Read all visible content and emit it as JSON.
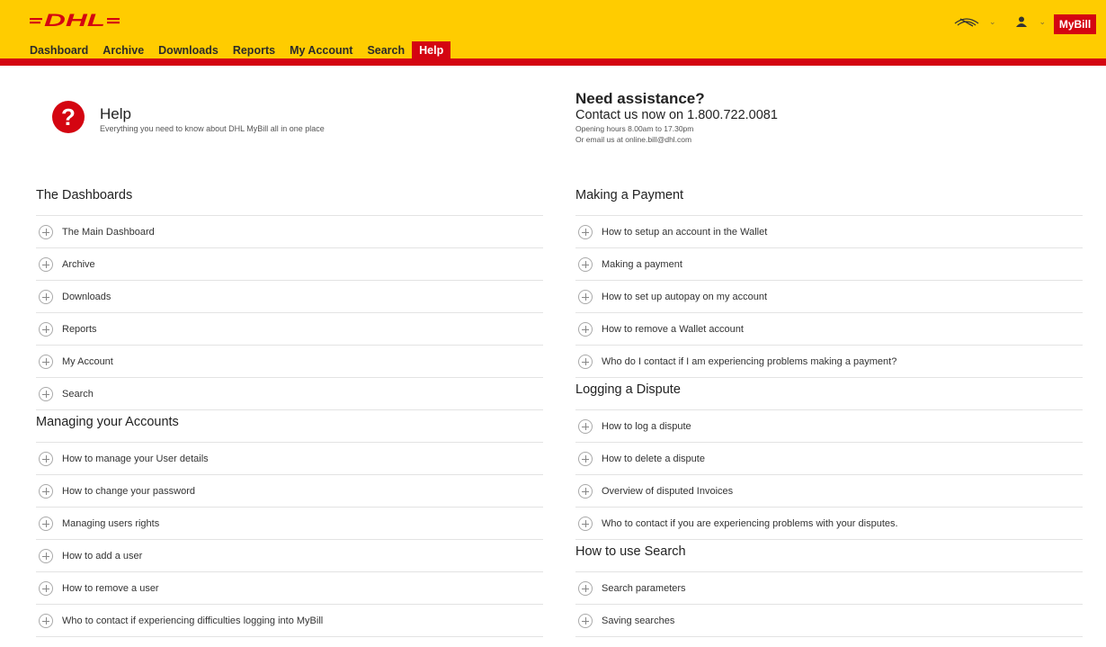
{
  "colors": {
    "header_bg": "#ffcc00",
    "accent_red": "#d40511"
  },
  "header": {
    "logo_text": "DHL",
    "nav": [
      {
        "label": "Dashboard"
      },
      {
        "label": "Archive"
      },
      {
        "label": "Downloads"
      },
      {
        "label": "Reports"
      },
      {
        "label": "My Account"
      },
      {
        "label": "Search"
      },
      {
        "label": "Help",
        "active": true
      }
    ],
    "icons": [
      "language-icon",
      "user-icon"
    ],
    "mybill_label": "MyBill"
  },
  "help": {
    "badge": "?",
    "title": "Help",
    "subtitle": "Everything you need to know about DHL MyBill all in one place"
  },
  "assistance": {
    "title": "Need assistance?",
    "contact": "Contact us now on 1.800.722.0081",
    "hours": "Opening hours 8.00am to 17.30pm",
    "email": "Or email us at online.bill@dhl.com"
  },
  "left_sections": [
    {
      "title": "The Dashboards",
      "items": [
        "The Main Dashboard",
        "Archive",
        "Downloads",
        "Reports",
        "My Account",
        "Search"
      ]
    },
    {
      "title": "Managing your Accounts",
      "items": [
        "How to manage your User details",
        "How to change your password",
        "Managing users rights",
        "How to add a user",
        "How to remove a user",
        "Who to contact if experiencing difficulties logging into MyBill"
      ]
    }
  ],
  "right_sections": [
    {
      "title": "Making a Payment",
      "items": [
        "How to setup an account in the Wallet",
        "Making a payment",
        "How to set up autopay on my account",
        "How to remove a Wallet account",
        "Who do I contact if I am experiencing problems making a payment?"
      ]
    },
    {
      "title": "Logging a Dispute",
      "items": [
        "How to log a dispute",
        "How to delete a dispute",
        "Overview of disputed Invoices",
        "Who to contact if you are experiencing problems with your disputes."
      ]
    },
    {
      "title": "How to use Search",
      "items": [
        "Search parameters",
        "Saving searches"
      ]
    }
  ]
}
